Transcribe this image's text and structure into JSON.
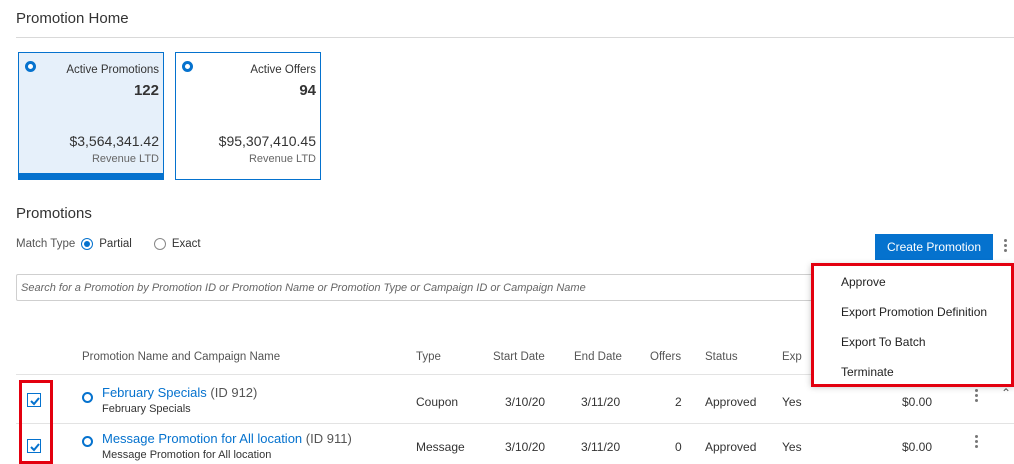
{
  "page": {
    "title": "Promotion Home"
  },
  "tiles": [
    {
      "label": "Active Promotions",
      "count": "122",
      "amount": "$3,564,341.42",
      "sublabel": "Revenue LTD",
      "selected": true
    },
    {
      "label": "Active Offers",
      "count": "94",
      "amount": "$95,307,410.45",
      "sublabel": "Revenue LTD",
      "selected": false
    }
  ],
  "promotions": {
    "title": "Promotions",
    "match_type_label": "Match Type",
    "match_options": [
      "Partial",
      "Exact"
    ],
    "match_selected": "Partial",
    "create_button": "Create Promotion",
    "search_placeholder": "Search for a Promotion by Promotion ID or Promotion Name or Promotion Type or Campaign ID or Campaign Name"
  },
  "table": {
    "headers": [
      "Promotion Name and Campaign Name",
      "Type",
      "Start Date",
      "End Date",
      "Offers",
      "Status",
      "Exp"
    ],
    "rows": [
      {
        "checked": true,
        "name": "February Specials",
        "id": "(ID 912)",
        "campaign": "February Specials",
        "type": "Coupon",
        "start": "3/10/20",
        "end": "3/11/20",
        "offers": "2",
        "status": "Approved",
        "exp": "Yes",
        "amount": "$0.00"
      },
      {
        "checked": true,
        "name": "Message Promotion for All location",
        "id": "(ID 911)",
        "campaign": "Message Promotion for All location",
        "type": "Message",
        "start": "3/10/20",
        "end": "3/11/20",
        "offers": "0",
        "status": "Approved",
        "exp": "Yes",
        "amount": "$0.00"
      }
    ]
  },
  "actions_menu": {
    "items": [
      "Approve",
      "Export Promotion Definition",
      "Export To Batch",
      "Terminate"
    ]
  },
  "colors": {
    "accent": "#0572ce",
    "highlight": "#e3000f",
    "tile_selected_bg": "#e6f0fa"
  }
}
